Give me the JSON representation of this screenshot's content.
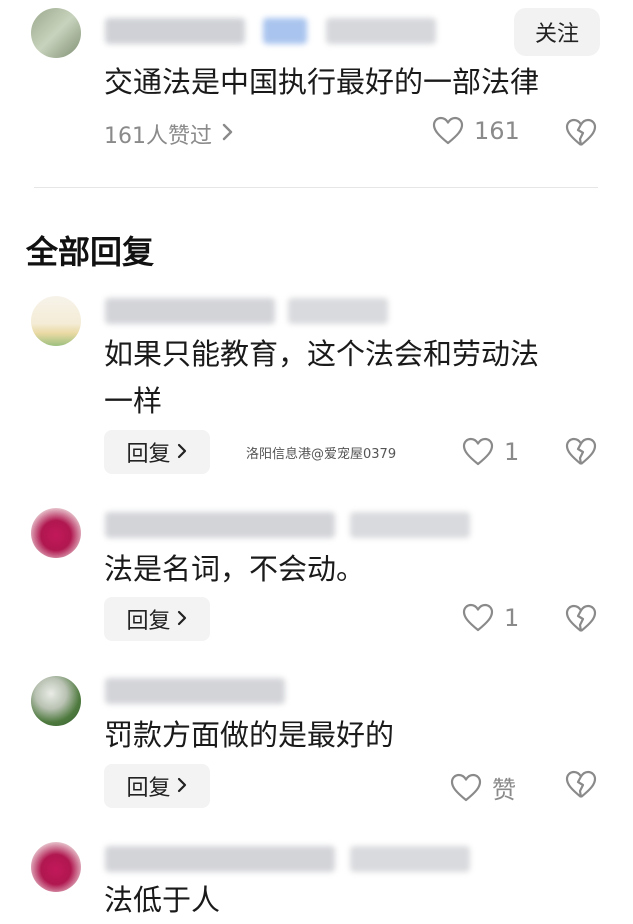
{
  "top_comment": {
    "follow_label": "关注",
    "text": "交通法是中国执行最好的一部法律",
    "liked_by": "161人赞过",
    "like_count": "161"
  },
  "section": {
    "title": "全部回复"
  },
  "replies": [
    {
      "lines": [
        "如果只能教育，这个法会和劳动法",
        "一样"
      ],
      "reply_label": "回复",
      "like_count": "1"
    },
    {
      "lines": [
        "法是名词，不会动。"
      ],
      "reply_label": "回复",
      "like_count": "1"
    },
    {
      "lines": [
        "罚款方面做的是最好的"
      ],
      "reply_label": "回复",
      "like_count": "赞"
    },
    {
      "lines": [
        "法低于人"
      ]
    }
  ],
  "watermark": "洛阳信息港@爱宠屋0379",
  "icons": {
    "chevron": "chevron-right-icon",
    "like": "heart-outline-icon",
    "dislike": "broken-heart-icon"
  },
  "colors": {
    "muted": "#8a8a8a",
    "button_bg": "#f3f3f3",
    "divider": "#e6e6e6"
  }
}
